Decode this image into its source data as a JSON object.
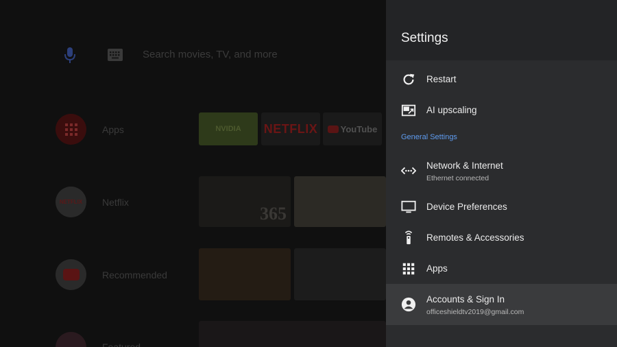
{
  "home": {
    "search_placeholder": "Search movies, TV, and more",
    "rows": [
      {
        "label": "Apps"
      },
      {
        "label": "Netflix"
      },
      {
        "label": "Recommended"
      },
      {
        "label": "Featured"
      }
    ],
    "app_tiles": [
      "NVIDIA",
      "NETFLIX",
      "YouTube"
    ],
    "featured_tile": "365",
    "netflix_icon_text": "NETFLIX"
  },
  "settings": {
    "title": "Settings",
    "quick_items": [
      {
        "label": "Restart",
        "icon": "restart-icon"
      },
      {
        "label": "AI upscaling",
        "icon": "ai-upscaling-icon"
      }
    ],
    "section_header": "General Settings",
    "items": [
      {
        "label": "Network & Internet",
        "sublabel": "Ethernet connected",
        "icon": "network-icon"
      },
      {
        "label": "Device Preferences",
        "icon": "tv-icon"
      },
      {
        "label": "Remotes & Accessories",
        "icon": "remote-icon"
      },
      {
        "label": "Apps",
        "icon": "apps-grid-icon"
      },
      {
        "label": "Accounts & Sign In",
        "sublabel": "officeshieldtv2019@gmail.com",
        "icon": "account-icon",
        "selected": true
      }
    ]
  },
  "colors": {
    "panel_bg": "#2b2c2e",
    "panel_header_bg": "#232426",
    "section_accent": "#5f9cf0",
    "selected_bg": "#3a3b3d"
  }
}
